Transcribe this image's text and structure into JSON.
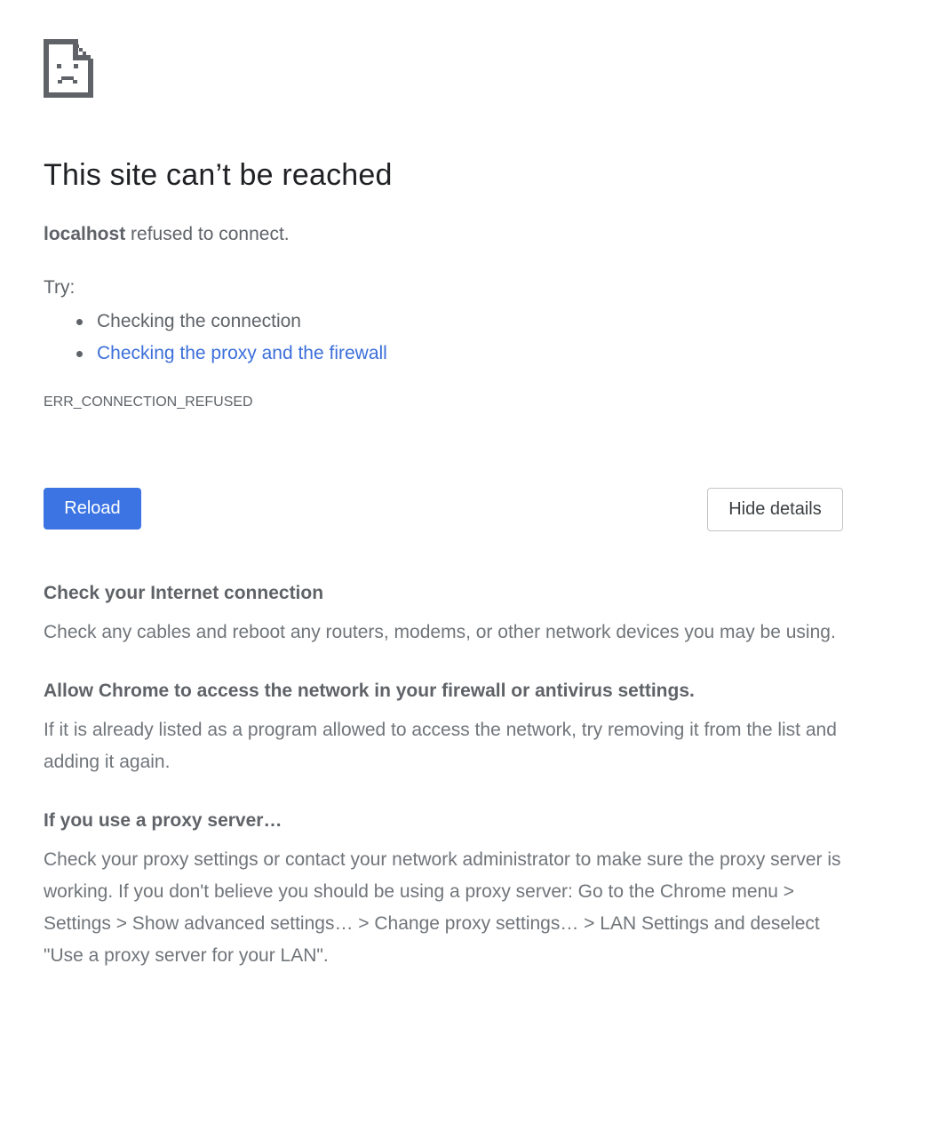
{
  "error": {
    "icon": "sad-page-icon",
    "title": "This site can’t be reached",
    "host": "localhost",
    "summary_suffix": " refused to connect.",
    "try_label": "Try:",
    "suggestions": [
      {
        "label": "Checking the connection",
        "link": false
      },
      {
        "label": "Checking the proxy and the firewall",
        "link": true
      }
    ],
    "code": "ERR_CONNECTION_REFUSED"
  },
  "buttons": {
    "reload": "Reload",
    "details": "Hide details"
  },
  "details": [
    {
      "heading": "Check your Internet connection",
      "body": "Check any cables and reboot any routers, modems, or other network devices you may be using."
    },
    {
      "heading": "Allow Chrome to access the network in your firewall or antivirus settings.",
      "body": "If it is already listed as a program allowed to access the network, try removing it from the list and adding it again."
    },
    {
      "heading": "If you use a proxy server…",
      "body": "Check your proxy settings or contact your network administrator to make sure the proxy server is working. If you don't believe you should be using a proxy server: Go to the Chrome menu > Settings > Show advanced settings… > Change proxy settings… > LAN Settings and deselect \"Use a proxy server for your LAN\"."
    }
  ],
  "colors": {
    "accent": "#3c74e3",
    "link": "#3c6fd9",
    "text_primary": "#202124",
    "text_secondary": "#5f6368"
  }
}
